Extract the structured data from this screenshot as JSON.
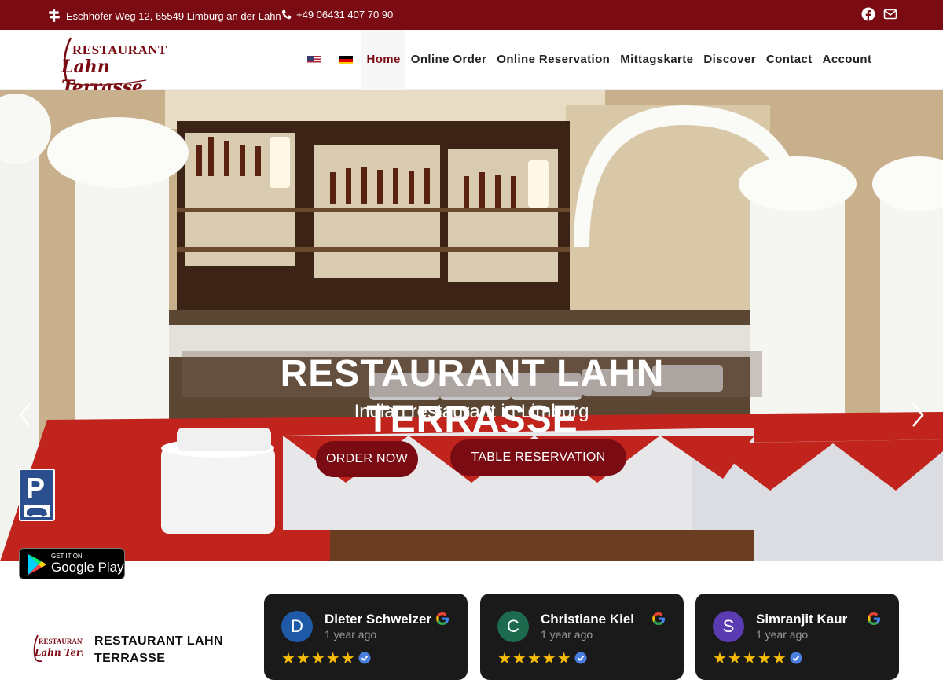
{
  "topbar": {
    "address": "Eschhöfer Weg 12, 65549 Limburg an der Lahn",
    "phone": "+49 06431 407 70 90",
    "social_icons": [
      "facebook-icon",
      "mail-icon"
    ]
  },
  "logo": {
    "line1": "RESTAURANT",
    "line2": "Lahn Terrasse"
  },
  "nav": {
    "flags": [
      "us-flag",
      "de-flag"
    ],
    "items": [
      "Home",
      "Online Order",
      "Online Reservation",
      "Mittagskarte",
      "Discover",
      "Contact",
      "Account"
    ],
    "active": "Home"
  },
  "hero": {
    "title": "RESTAURANT LAHN TERRASSE",
    "subtitle": "Indian restaurant in Limburg",
    "order_button": "ORDER NOW",
    "reservation_button": "TABLE RESERVATION"
  },
  "badges": {
    "parking": "P",
    "google_play_small": "GET IT ON",
    "google_play_big": "Google Play"
  },
  "business": {
    "name_line1": "RESTAURANT LAHN",
    "name_line2": "TERRASSE"
  },
  "reviews": [
    {
      "initial": "D",
      "name": "Dieter Schweizer",
      "time": "1 year ago",
      "stars": "★★★★★",
      "avatar_color": "#1e5aa8"
    },
    {
      "initial": "C",
      "name": "Christiane Kiel",
      "time": "1 year ago",
      "stars": "★★★★★",
      "avatar_color": "#1d6b4f"
    },
    {
      "initial": "S",
      "name": "Simranjit Kaur",
      "time": "1 year ago",
      "stars": "★★★★★",
      "avatar_color": "#5b3bb2"
    }
  ],
  "colors": {
    "brand": "#7a0b13",
    "card_bg": "#1a1a1a",
    "star": "#f6bb06"
  }
}
